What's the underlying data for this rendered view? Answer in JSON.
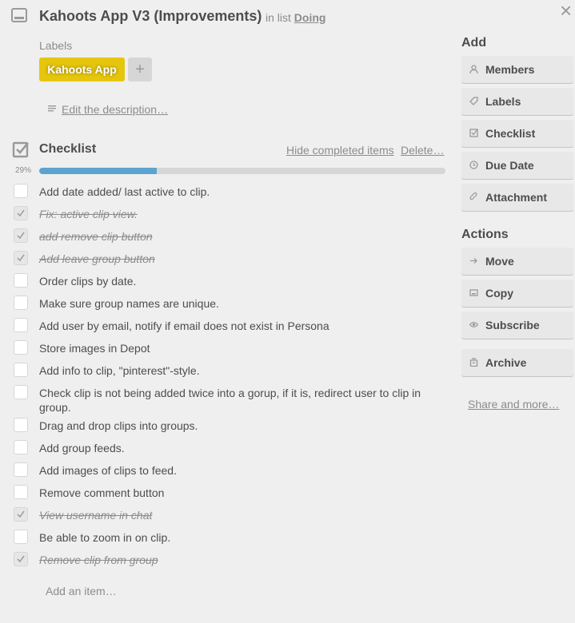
{
  "card": {
    "title": "Kahoots App V3 (Improvements)",
    "in_list_prefix": "in list",
    "list_name": "Doing",
    "close_glyph": "×"
  },
  "labels": {
    "heading": "Labels",
    "items": [
      "Kahoots App"
    ],
    "add_glyph": "+",
    "label_color": "#e6c60d"
  },
  "description": {
    "link": "Edit the description…"
  },
  "checklist": {
    "title": "Checklist",
    "hide_completed": "Hide completed items",
    "delete": "Delete…",
    "progress_text": "29%",
    "progress_value": 0.29,
    "progress_color": "#5ba4cf",
    "items": [
      {
        "text": "Add date added/ last active to clip.",
        "done": false
      },
      {
        "text": "Fix: active clip view.",
        "done": true
      },
      {
        "text": "add remove clip button",
        "done": true
      },
      {
        "text": "Add leave group button",
        "done": true
      },
      {
        "text": "Order clips by date.",
        "done": false
      },
      {
        "text": "Make sure group names are unique.",
        "done": false
      },
      {
        "text": "Add user by email, notify if email does not exist in Persona",
        "done": false
      },
      {
        "text": "Store images in Depot",
        "done": false
      },
      {
        "text": "Add info to clip, \"pinterest\"-style.",
        "done": false
      },
      {
        "text": "Check clip is not being added twice into a gorup, if it is, redirect user to clip in group.",
        "done": false
      },
      {
        "text": "Drag and drop clips into groups.",
        "done": false
      },
      {
        "text": "Add group feeds.",
        "done": false
      },
      {
        "text": "Add images of clips to feed.",
        "done": false
      },
      {
        "text": "Remove comment button",
        "done": false
      },
      {
        "text": "View username in chat",
        "done": true
      },
      {
        "text": "Be able to zoom in on clip.",
        "done": false
      },
      {
        "text": "Remove clip from group",
        "done": true
      }
    ],
    "add_item_placeholder": "Add an item…"
  },
  "sidebar": {
    "add_heading": "Add",
    "add_buttons": [
      {
        "label": "Members",
        "icon": "person-icon"
      },
      {
        "label": "Labels",
        "icon": "tag-icon"
      },
      {
        "label": "Checklist",
        "icon": "checkbox-icon"
      },
      {
        "label": "Due Date",
        "icon": "clock-icon"
      },
      {
        "label": "Attachment",
        "icon": "paperclip-icon"
      }
    ],
    "actions_heading": "Actions",
    "action_buttons": [
      {
        "label": "Move",
        "icon": "arrow-right-icon"
      },
      {
        "label": "Copy",
        "icon": "copy-icon"
      },
      {
        "label": "Subscribe",
        "icon": "eye-icon"
      },
      {
        "label": "Archive",
        "icon": "archive-icon"
      }
    ],
    "share": "Share and more…"
  }
}
